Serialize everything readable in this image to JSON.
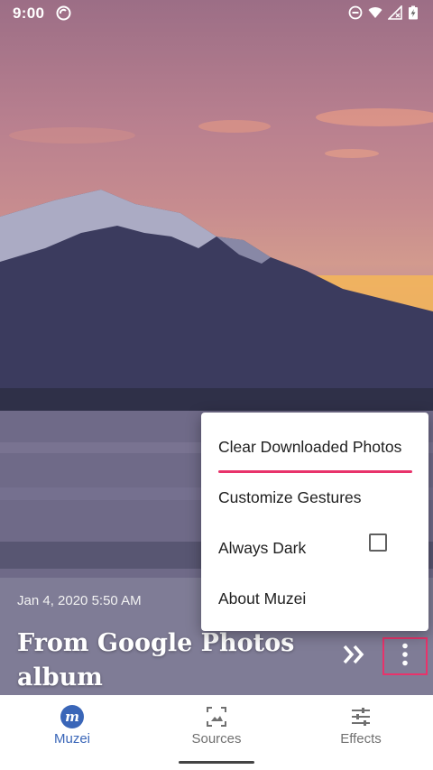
{
  "status_bar": {
    "time": "9:00",
    "left_icon": "sync-icon",
    "right_icons": [
      "do-not-disturb-icon",
      "wifi-icon",
      "signal-icon",
      "battery-charging-icon"
    ]
  },
  "artwork": {
    "date": "Jan 4, 2020 5:50 AM",
    "title": "From Google Photos album"
  },
  "actions": {
    "next_icon": "double-chevron-right-icon",
    "overflow_icon": "more-vertical-icon"
  },
  "menu": {
    "items": [
      {
        "label": "Clear Downloaded Photos",
        "highlighted": true
      },
      {
        "label": "Customize Gestures"
      },
      {
        "label": "Always Dark",
        "checkbox": true,
        "checked": false
      },
      {
        "label": "About Muzei"
      }
    ]
  },
  "bottom_nav": {
    "items": [
      {
        "label": "Muzei",
        "icon": "muzei-logo-icon",
        "active": true
      },
      {
        "label": "Sources",
        "icon": "sources-icon",
        "active": false
      },
      {
        "label": "Effects",
        "icon": "sliders-icon",
        "active": false
      }
    ]
  },
  "colors": {
    "accent": "#e8336b",
    "active_nav": "#3a66b8"
  }
}
